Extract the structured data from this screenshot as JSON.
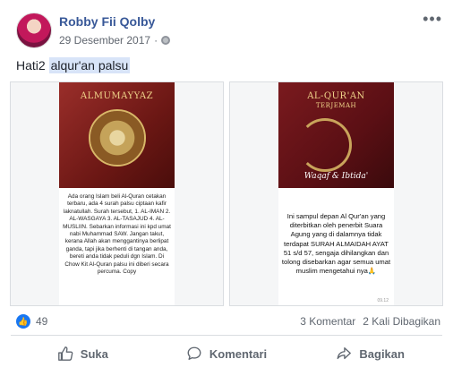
{
  "post": {
    "author": "Robby Fii Qolby",
    "date": "29 Desember 2017",
    "separator": "·",
    "text_prefix": "Hati2 ",
    "text_highlight": "alqur'an palsu"
  },
  "photos": [
    {
      "book_title": "ALMUMAYYAZ",
      "book_subtitle": "",
      "caption": "Ada orang Islam beli Al-Quran cetakan terbaru, ada 4 surah palsu ciptaan kafir laknatullah. Surah tersebut, 1. AL-IMAN 2. AL-WASGAYA 3. AL-TASAJUD 4. AL-MUSLIIN. Sebarkan informasi ini kpd umat nabi Muhammad SAW. Jangan takut, kerana Allah akan menggantinya berlipat ganda, tapi jika berhenti di tangan anda, bereti anda tidak peduli dgn Islam. Di Chow Kit Al-Quran palsu ini diberi secara percuma. Copy",
      "script": ""
    },
    {
      "book_title": "AL-QUR'AN",
      "book_subtitle": "TERJEMAH",
      "caption": "Ini sampul depan Al Qur'an yang diterbitkan oleh penerbit Suara Agung yang di dalamnya tidak terdapat SURAH ALMAIDAH AYAT 51 s/d 57, sengaja dihilangkan dan tolong disebarkan agar semua umat muslim mengetahui nya🙏",
      "script": "Waqaf & Ibtida'",
      "stamp": "09.12"
    }
  ],
  "stats": {
    "like_count": "49",
    "comments": "3 Komentar",
    "shares": "2 Kali Dibagikan"
  },
  "actions": {
    "like": "Suka",
    "comment": "Komentari",
    "share": "Bagikan"
  },
  "icons": {
    "more": "•••",
    "like_badge": "👍"
  },
  "colors": {
    "author": "#385898",
    "accent": "#1877f2",
    "highlight": "#d8e4f8"
  }
}
